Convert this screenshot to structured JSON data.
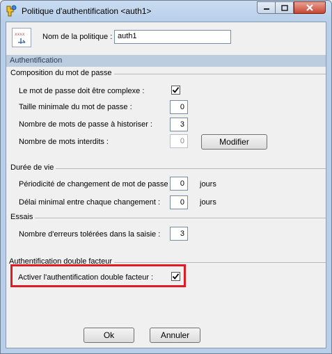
{
  "window": {
    "title": "Politique d'authentification <auth1>",
    "icons": {
      "app": "key-icon",
      "minimize": "minimize-icon",
      "maximize": "maximize-icon",
      "close": "close-icon"
    }
  },
  "policy": {
    "name_label": "Nom de la politique :",
    "name_value": "auth1",
    "icon": "policy-icon"
  },
  "section": "Authentification",
  "composition": {
    "title": "Composition du mot de passe",
    "complex_label": "Le mot de passe doit être complexe :",
    "complex_checked": true,
    "min_length_label": "Taille minimale du mot de passe :",
    "min_length_value": "0",
    "history_label": "Nombre de mots de passe à historiser :",
    "history_value": "3",
    "forbidden_label": "Nombre de mots interdits :",
    "forbidden_value": "0",
    "modify_button": "Modifier"
  },
  "lifetime": {
    "title": "Durée de vie",
    "change_period_label": "Périodicité de changement de mot de passe :",
    "change_period_value": "0",
    "change_period_unit": "jours",
    "min_delay_label": "Délai minimal entre chaque changement :",
    "min_delay_value": "0",
    "min_delay_unit": "jours"
  },
  "attempts": {
    "title": "Essais",
    "errors_label": "Nombre d'erreurs tolérées dans la saisie :",
    "errors_value": "3"
  },
  "two_factor": {
    "title": "Authentification double facteur",
    "enable_label": "Activer l'authentification double facteur :",
    "enable_checked": true,
    "highlight_color": "#e01b24"
  },
  "buttons": {
    "ok": "Ok",
    "cancel": "Annuler"
  }
}
